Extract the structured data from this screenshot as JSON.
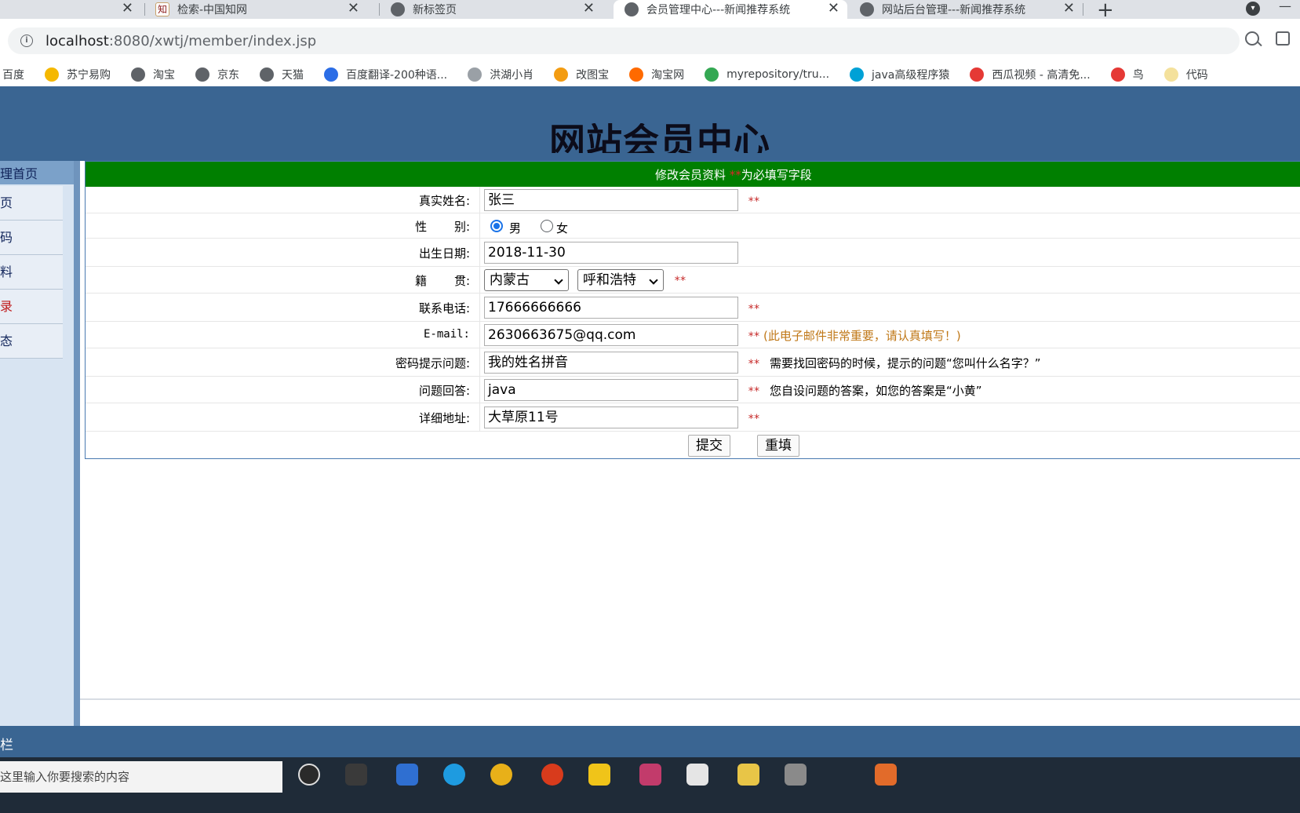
{
  "browser": {
    "tabs": [
      {
        "title": "",
        "closable": true
      },
      {
        "title": "检索-中国知网",
        "icon": "cnki-icon"
      },
      {
        "title": "新标签页",
        "icon": "chrome-icon"
      },
      {
        "title": "会员管理中心---新闻推荐系统",
        "icon": "globe-icon",
        "active": true
      },
      {
        "title": "网站后台管理---新闻推荐系统",
        "icon": "globe-icon"
      }
    ],
    "new_tab": "+",
    "url_host": "localhost",
    "url_path": ":8080/xwtj/member/index.jsp",
    "bookmarks": [
      {
        "label": "百度",
        "color": ""
      },
      {
        "label": "苏宁易购",
        "color": "#f5b800"
      },
      {
        "label": "淘宝",
        "color": "#5f6368"
      },
      {
        "label": "京东",
        "color": "#5f6368"
      },
      {
        "label": "天猫",
        "color": "#5f6368"
      },
      {
        "label": "百度翻译-200种语...",
        "color": "#2b6de6"
      },
      {
        "label": "洪湖小肖",
        "color": "#9aa0a6"
      },
      {
        "label": "改图宝",
        "color": "#f39c12"
      },
      {
        "label": "淘宝网",
        "color": "#ff6a00"
      },
      {
        "label": "myrepository/tru...",
        "color": "#34a853"
      },
      {
        "label": "java高级程序猿",
        "color": "#00a1d6"
      },
      {
        "label": "西瓜视频 - 高清免...",
        "color": "#e53935"
      },
      {
        "label": "鸟",
        "color": "#e53935"
      },
      {
        "label": "代码",
        "color": "#f4e19c"
      }
    ]
  },
  "page": {
    "title": "网站会员中心",
    "sidebar": {
      "header": "理首页",
      "items": [
        {
          "label": "页",
          "red": false
        },
        {
          "label": "码",
          "red": false
        },
        {
          "label": "料",
          "red": false
        },
        {
          "label": "录",
          "red": true
        },
        {
          "label": "态",
          "red": false
        }
      ]
    },
    "form": {
      "header": "修改会员资料",
      "header_stars": "**",
      "header_note": "为必填写字段",
      "labels": {
        "real_name": "真实姓名:",
        "gender": "性　　 别:",
        "birth": "出生日期:",
        "native": "籍　　 贯:",
        "phone": "联系电话:",
        "email": "E-mail:",
        "question": "密码提示问题:",
        "answer": "问题回答:",
        "address": "详细地址:"
      },
      "values": {
        "real_name": "张三",
        "gender_male": "男",
        "gender_female": "女",
        "birth": "2018-11-30",
        "province": "内蒙古",
        "city": "呼和浩特",
        "phone": "17666666666",
        "email": "2630663675@qq.com",
        "question": "我的姓名拼音",
        "answer": "java",
        "address": "大草原11号"
      },
      "required_mark": "**",
      "hints": {
        "email": "(此电子邮件非常重要，请认真填写！)",
        "question": "需要找回密码的时候，提示的问题“您叫什么名字？”",
        "answer": "您自设问题的答案，如您的答案是“小黄”"
      },
      "buttons": {
        "submit": "提交",
        "reset": "重填"
      }
    },
    "footer": "栏",
    "taskbar_search": "这里输入你要搜索的内容"
  }
}
